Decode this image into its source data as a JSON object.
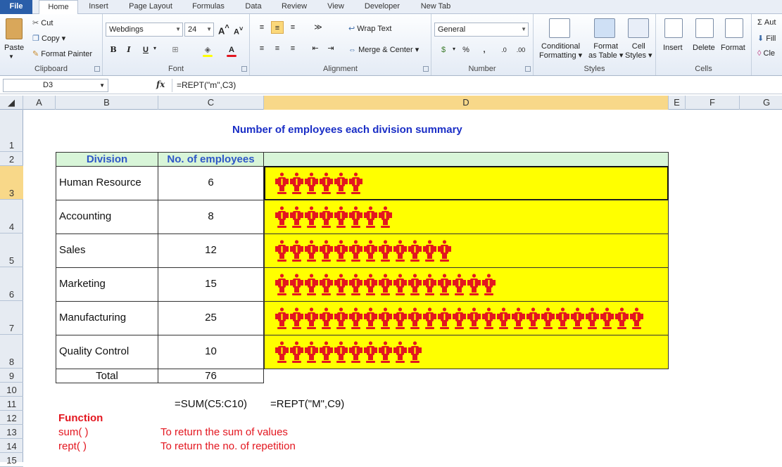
{
  "ribbon_tabs": [
    "File",
    "Home",
    "Insert",
    "Page Layout",
    "Formulas",
    "Data",
    "Review",
    "View",
    "Developer",
    "New Tab"
  ],
  "clipboard": {
    "paste": "Paste",
    "cut": "Cut",
    "copy": "Copy",
    "format_painter": "Format Painter",
    "label": "Clipboard"
  },
  "font": {
    "name": "Webdings",
    "size": "24",
    "bold": "B",
    "italic": "I",
    "underline": "U",
    "label": "Font"
  },
  "alignment": {
    "wrap_text": "Wrap Text",
    "merge_center": "Merge & Center",
    "label": "Alignment"
  },
  "number": {
    "format": "General",
    "percent": "%",
    "comma": ",",
    "label": "Number"
  },
  "styles": {
    "conditional": "Conditional",
    "conditional2": "Formatting",
    "format_as": "Format",
    "format_as2": "as Table",
    "cell": "Cell",
    "cell2": "Styles",
    "label": "Styles"
  },
  "cells": {
    "insert": "Insert",
    "delete": "Delete",
    "format": "Format",
    "label": "Cells"
  },
  "editing": {
    "autosum": "Aut",
    "fill": "Fill",
    "clear": "Cle"
  },
  "formula_bar": {
    "name_box": "D3",
    "fx": "fx",
    "formula": "=REPT(\"m\",C3)"
  },
  "columns": [
    "A",
    "B",
    "C",
    "D",
    "E",
    "F",
    "G"
  ],
  "rows": [
    "1",
    "2",
    "3",
    "4",
    "5",
    "6",
    "7",
    "8",
    "9",
    "10",
    "11",
    "12",
    "13",
    "14",
    "15"
  ],
  "sheet": {
    "title": "Number of employees each division summary",
    "header_division": "Division",
    "header_employees": "No. of employees",
    "divisions": [
      {
        "name": "Human Resource",
        "count": "6",
        "icons": 6
      },
      {
        "name": "Accounting",
        "count": "8",
        "icons": 8
      },
      {
        "name": "Sales",
        "count": "12",
        "icons": 12
      },
      {
        "name": "Marketing",
        "count": "15",
        "icons": 15
      },
      {
        "name": "Manufacturing",
        "count": "25",
        "icons": 25
      },
      {
        "name": "Quality Control",
        "count": "10",
        "icons": 10
      }
    ],
    "total_label": "Total",
    "total_value": "76",
    "formula_sum": "=SUM(C5:C10)",
    "formula_rept": "=REPT(\"M\",C9)",
    "function_heading": "Function",
    "fn1_name": "sum( )",
    "fn1_desc": "To return the sum of values",
    "fn2_name": "rept( )",
    "fn2_desc": "To return the no. of repetition"
  },
  "colors": {
    "icon": "#e3161f",
    "bar_fill": "#ffff00",
    "header_fill": "#d8f5d8",
    "title": "#1a2ec6",
    "function_text": "#e3161f"
  }
}
